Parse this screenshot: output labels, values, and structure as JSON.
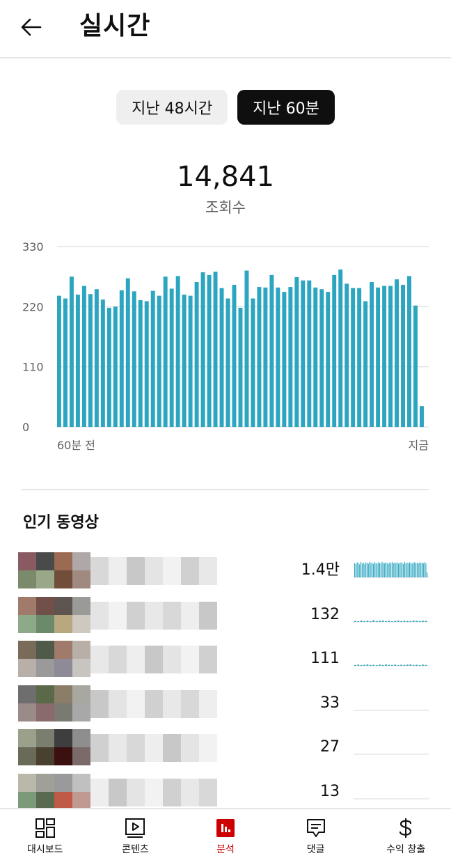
{
  "header": {
    "title": "실시간",
    "back_icon": "arrow-left-icon"
  },
  "range_chips": [
    {
      "label": "지난 48시간",
      "selected": false
    },
    {
      "label": "지난 60분",
      "selected": true
    }
  ],
  "summary": {
    "total": "14,841",
    "label": "조회수"
  },
  "chart_data": {
    "type": "bar",
    "x_start_label": "60분 전",
    "x_end_label": "지금",
    "y_ticks": [
      "330",
      "220",
      "110",
      "0"
    ],
    "ylim": [
      0,
      330
    ],
    "grid": true,
    "color": "#2ba5c0",
    "values": [
      240,
      235,
      275,
      242,
      258,
      243,
      252,
      233,
      218,
      220,
      250,
      272,
      248,
      232,
      230,
      249,
      240,
      275,
      253,
      276,
      242,
      240,
      265,
      283,
      278,
      284,
      254,
      235,
      260,
      218,
      286,
      235,
      256,
      255,
      278,
      255,
      247,
      256,
      274,
      268,
      268,
      255,
      252,
      247,
      278,
      288,
      262,
      254,
      254,
      230,
      265,
      255,
      258,
      258,
      270,
      260,
      276,
      222,
      38
    ]
  },
  "popular_videos": {
    "title": "인기 동영상",
    "items": [
      {
        "count": "1.4만",
        "trend": [
          0.85,
          0.8,
          0.9,
          0.86,
          0.78,
          0.92,
          0.84,
          0.88,
          0.8,
          0.9,
          0.86,
          0.82,
          0.94,
          0.85,
          0.88,
          0.8,
          0.91,
          0.86,
          0.83,
          0.9,
          0.87,
          0.82,
          0.93,
          0.86,
          0.84,
          0.9,
          0.86,
          0.8,
          0.89,
          0.85,
          0.92,
          0.84,
          0.88,
          0.86,
          0.9,
          0.82,
          0.87,
          0.9,
          0.85,
          0.8,
          0.92,
          0.85,
          0.88,
          0.84,
          0.9,
          0.86,
          0.82,
          0.88,
          0.91,
          0.85,
          0.87,
          0.83,
          0.9,
          0.86,
          0.88,
          0.84,
          0.9,
          0.85,
          0.3
        ]
      },
      {
        "count": "132",
        "trend": [
          0.06,
          0.04,
          0.08,
          0.05,
          0.07,
          0.04,
          0.1,
          0.05,
          0.06,
          0.08,
          0.05,
          0.07,
          0.04,
          0.06,
          0.08,
          0.05,
          0.07,
          0.06,
          0.05,
          0.08,
          0.06,
          0.05,
          0.07,
          0.06
        ]
      },
      {
        "count": "111",
        "trend": [
          0.05,
          0.07,
          0.04,
          0.06,
          0.08,
          0.05,
          0.06,
          0.04,
          0.07,
          0.05,
          0.08,
          0.06,
          0.05,
          0.07,
          0.04,
          0.06,
          0.05,
          0.07,
          0.08,
          0.05,
          0.06,
          0.04,
          0.07,
          0.05
        ]
      },
      {
        "count": "33",
        "trend": []
      },
      {
        "count": "27",
        "trend": []
      },
      {
        "count": "13",
        "trend": []
      }
    ]
  },
  "bottom_nav": [
    {
      "label": "대시보드",
      "icon": "dashboard-icon",
      "active": false
    },
    {
      "label": "콘텐츠",
      "icon": "content-icon",
      "active": false
    },
    {
      "label": "분석",
      "icon": "analytics-icon",
      "active": true
    },
    {
      "label": "댓글",
      "icon": "comments-icon",
      "active": false
    },
    {
      "label": "수익 창출",
      "icon": "dollar-icon",
      "active": false
    }
  ]
}
